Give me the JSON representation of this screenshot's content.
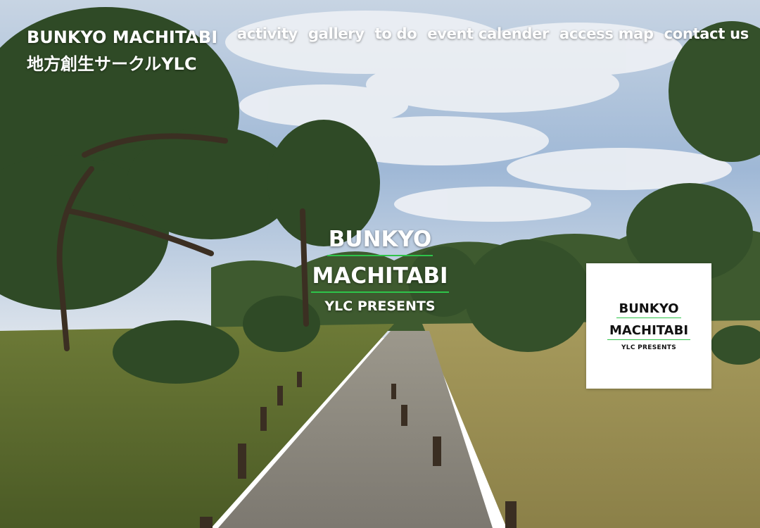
{
  "site": {
    "title_line1": "BUNKYO MACHITABI",
    "title_line2": "地方創生サークルYLC"
  },
  "nav": {
    "items": [
      {
        "label": "activity"
      },
      {
        "label": "gallery"
      },
      {
        "label": "to do"
      },
      {
        "label": "event calender"
      },
      {
        "label": "access map"
      },
      {
        "label": "contact us"
      }
    ]
  },
  "hero": {
    "logo_line1": "BUNKYO",
    "logo_line2": "MACHITABI",
    "logo_tagline": "YLC PRESENTS"
  },
  "logo_card": {
    "line1": "BUNKYO",
    "line2": "MACHITABI",
    "tagline": "YLC PRESENTS"
  },
  "colors": {
    "accent_green": "#2ec44a",
    "nav_text": "#ffffff"
  }
}
